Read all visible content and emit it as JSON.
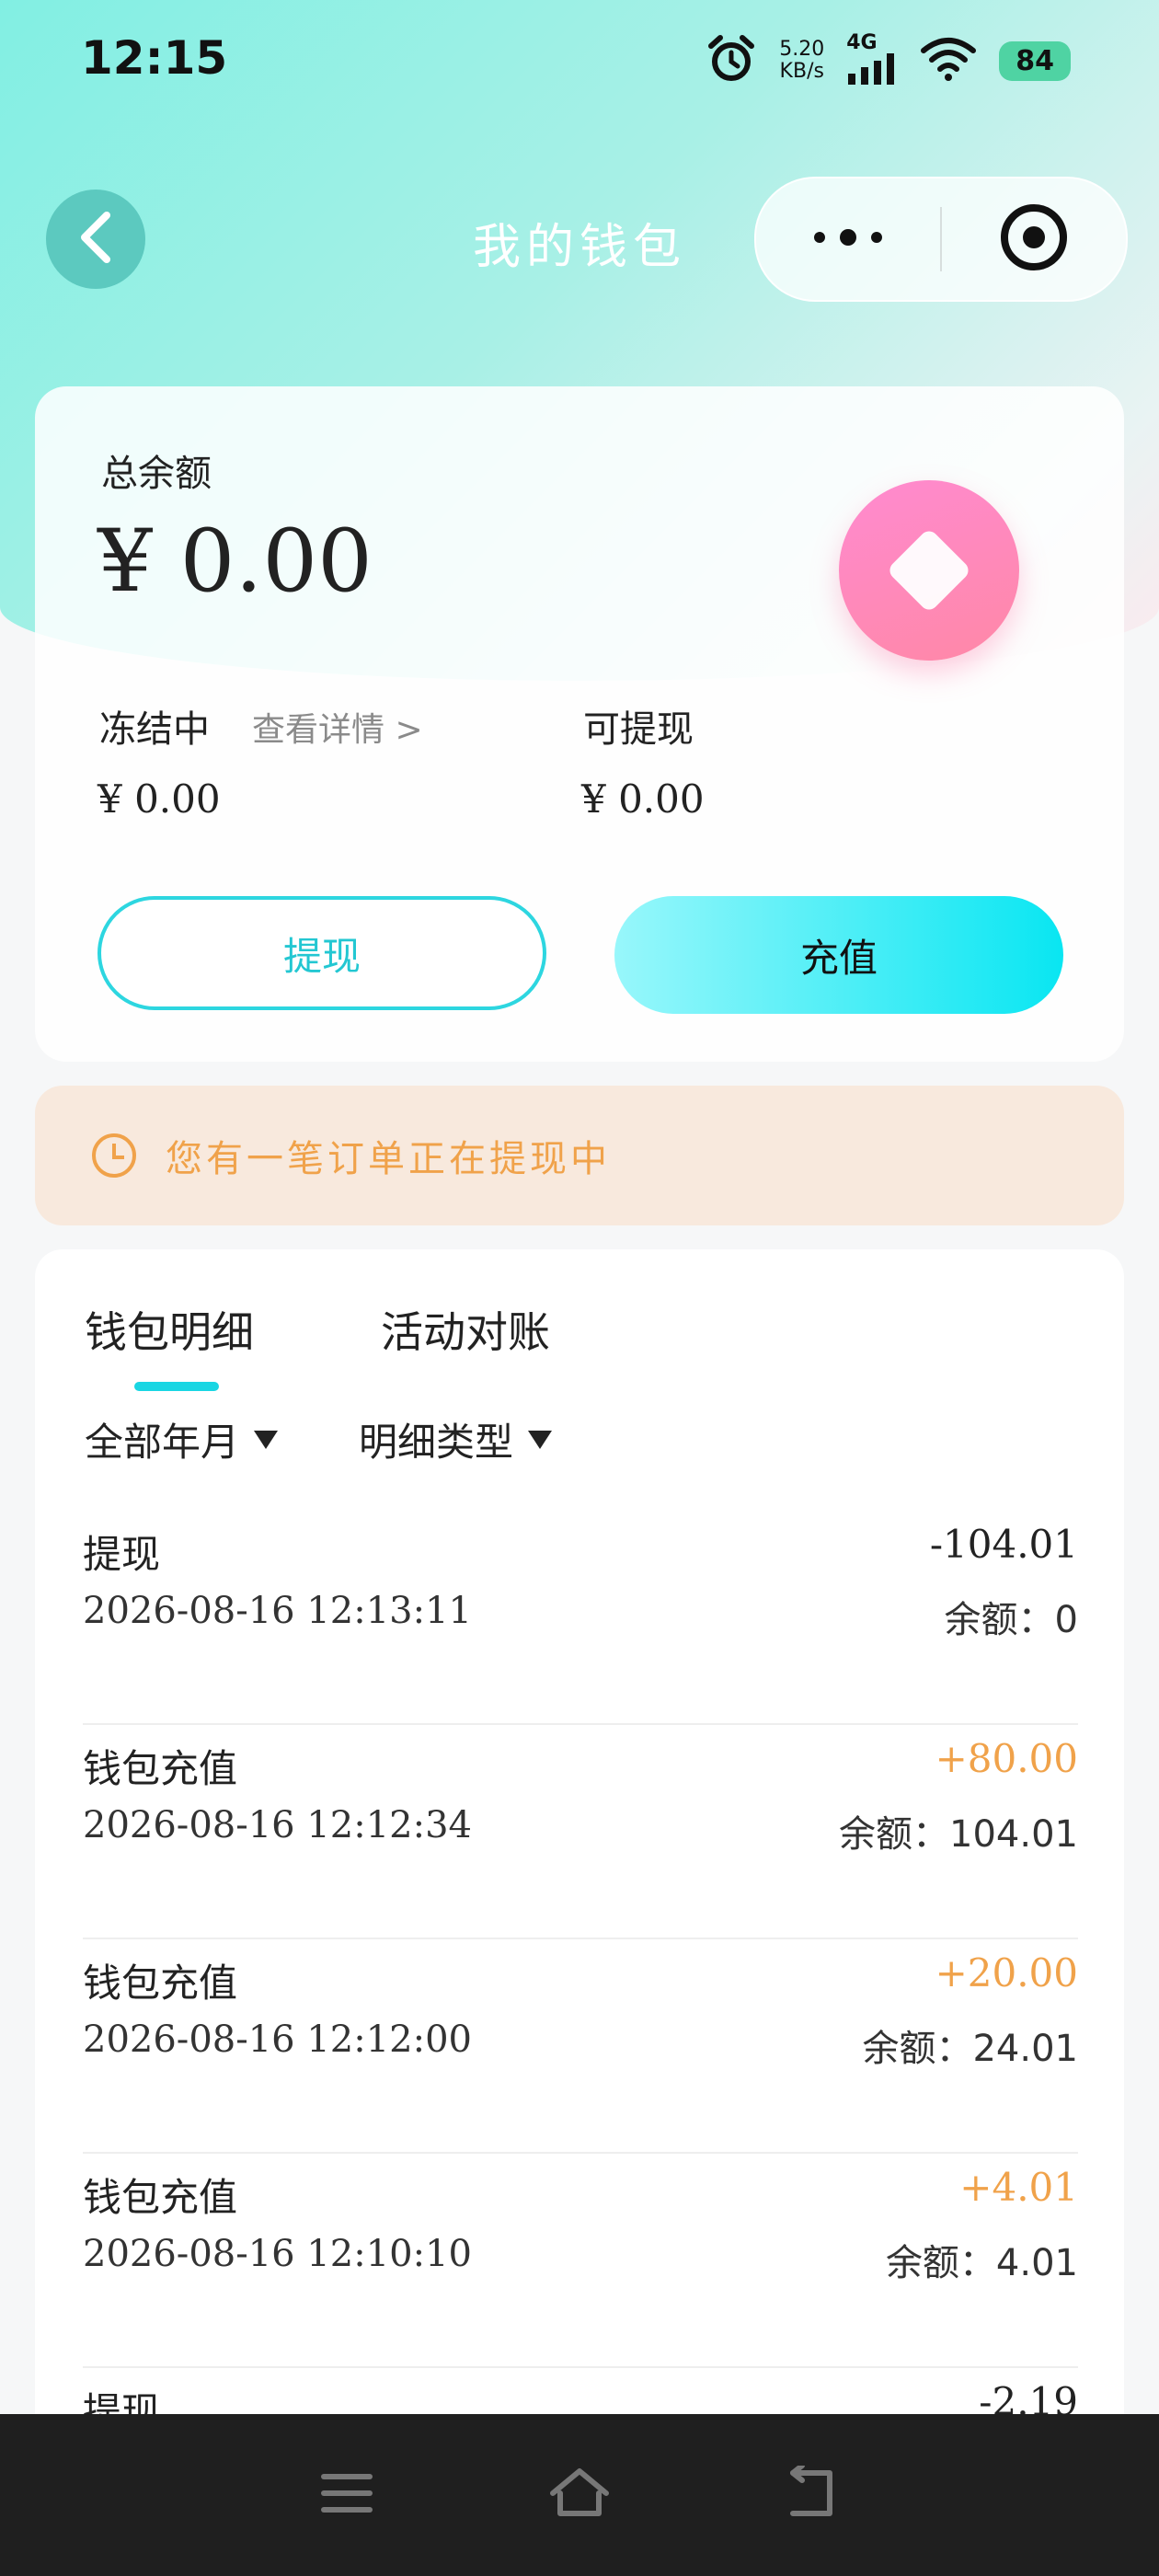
{
  "status": {
    "time": "12:15",
    "speed_value": "5.20",
    "speed_unit": "KB/s",
    "network": "4G",
    "battery": "84"
  },
  "nav": {
    "title": "我的钱包"
  },
  "balance": {
    "total_label": "总余额",
    "total_value": "¥ 0.00",
    "frozen_label": "冻结中",
    "frozen_detail": "查看详情 >",
    "frozen_value": "¥ 0.00",
    "available_label": "可提现",
    "available_value": "¥ 0.00",
    "withdraw_label": "提现",
    "recharge_label": "充值"
  },
  "notice": {
    "text": "您有一笔订单正在提现中"
  },
  "tabs": [
    {
      "label": "钱包明细",
      "active": true
    },
    {
      "label": "活动对账",
      "active": false
    }
  ],
  "filters": {
    "year_month": "全部年月",
    "type": "明细类型"
  },
  "transactions": [
    {
      "title": "提现",
      "time": "2026-08-16 12:13:11",
      "amount": "-104.01",
      "balance": "余额：0",
      "positive": false
    },
    {
      "title": "钱包充值",
      "time": "2026-08-16 12:12:34",
      "amount": "+80.00",
      "balance": "余额：104.01",
      "positive": true
    },
    {
      "title": "钱包充值",
      "time": "2026-08-16 12:12:00",
      "amount": "+20.00",
      "balance": "余额：24.01",
      "positive": true
    },
    {
      "title": "钱包充值",
      "time": "2026-08-16 12:10:10",
      "amount": "+4.01",
      "balance": "余额：4.01",
      "positive": true
    },
    {
      "title": "提现",
      "time": "",
      "amount": "-2.19",
      "balance": "",
      "positive": false
    }
  ],
  "colors": {
    "accent": "#19d6e3",
    "positive_amount": "#f0a24a",
    "notice_bg": "#f8e9dd",
    "pink_button": "#ff88b8"
  },
  "icons": {
    "status": [
      "alarm-icon",
      "signal-icon",
      "wifi-icon"
    ],
    "nav": [
      "back-chevron-icon",
      "more-dots-icon",
      "target-circle-icon"
    ],
    "bottom": [
      "menu-icon",
      "home-icon",
      "back-icon"
    ]
  }
}
